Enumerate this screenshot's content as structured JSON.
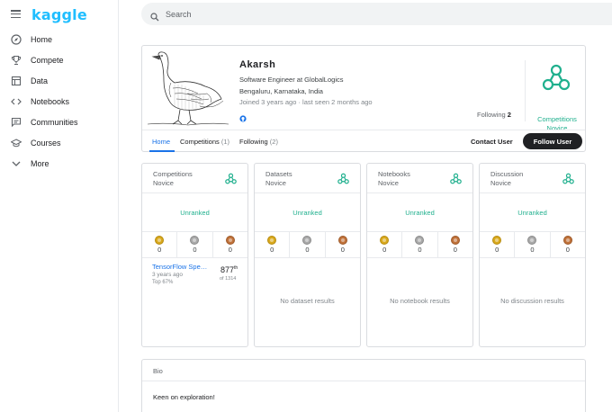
{
  "brand": {
    "logo_text": "kaggle",
    "accent": "#20beff"
  },
  "nav": {
    "items": [
      {
        "label": "Home",
        "icon": "compass-icon"
      },
      {
        "label": "Compete",
        "icon": "trophy-icon"
      },
      {
        "label": "Data",
        "icon": "table-icon"
      },
      {
        "label": "Notebooks",
        "icon": "code-icon"
      },
      {
        "label": "Communities",
        "icon": "chat-icon"
      },
      {
        "label": "Courses",
        "icon": "graduation-cap-icon"
      },
      {
        "label": "More",
        "icon": "chevron-down-icon"
      }
    ]
  },
  "search": {
    "placeholder": "Search"
  },
  "profile": {
    "name": "Akarsh",
    "occupation": "Software Engineer at GlobalLogics",
    "location": "Bengaluru, Karnataka, India",
    "joined": "Joined 3 years ago · last seen 2 months ago",
    "following_label": "Following",
    "following_count": "2",
    "tier_line1": "Competitions",
    "tier_line2": "Novice",
    "tier_color": "#20b08e"
  },
  "tabs": {
    "home": "Home",
    "competitions": "Competitions",
    "competitions_count": "(1)",
    "following": "Following",
    "following_count": "(2)",
    "contact": "Contact User",
    "follow": "Follow User"
  },
  "cards": [
    {
      "title1": "Competitions",
      "title2": "Novice",
      "rank": "Unranked",
      "gold": "0",
      "silver": "0",
      "bronze": "0"
    },
    {
      "title1": "Datasets",
      "title2": "Novice",
      "rank": "Unranked",
      "gold": "0",
      "silver": "0",
      "bronze": "0",
      "empty": "No dataset results"
    },
    {
      "title1": "Notebooks",
      "title2": "Novice",
      "rank": "Unranked",
      "gold": "0",
      "silver": "0",
      "bronze": "0",
      "empty": "No notebook results"
    },
    {
      "title1": "Discussion",
      "title2": "Novice",
      "rank": "Unranked",
      "gold": "0",
      "silver": "0",
      "bronze": "0",
      "empty": "No discussion results"
    }
  ],
  "competition_entry": {
    "name": "TensorFlow Speech Recognition Challenge",
    "ago": "3 years ago",
    "top": "Top 67%",
    "rank": "877",
    "rank_suffix": "th",
    "of_total": "of 1314"
  },
  "bio": {
    "heading": "Bio",
    "text": "Keen on exploration!"
  }
}
